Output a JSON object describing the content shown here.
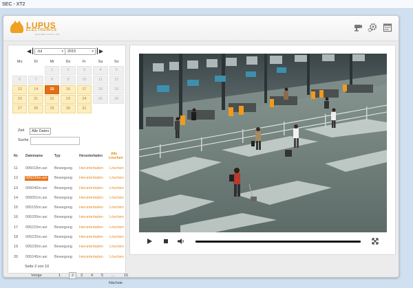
{
  "window": {
    "title": "SEC - XT2"
  },
  "header": {
    "logo_name": "LUPUS",
    "logo_sub": "ELECTRONICS",
    "logo_tagline": "SECURE YOUR LIFE",
    "icons": [
      "camera-icon",
      "gear-icon",
      "calendar-icon"
    ]
  },
  "calendar": {
    "month": "Jul",
    "year": "2015",
    "weekdays": [
      "Mo",
      "Di",
      "Mi",
      "Do",
      "Fr",
      "Sa",
      "So"
    ],
    "rows": [
      [
        "",
        "",
        "1",
        "2",
        "3",
        "4",
        "5"
      ],
      [
        "6",
        "7",
        "8",
        "9",
        "10",
        "11",
        "12"
      ],
      [
        "13",
        "14",
        "15",
        "16",
        "17",
        "18",
        "19"
      ],
      [
        "20",
        "21",
        "22",
        "23",
        "24",
        "25",
        "26"
      ],
      [
        "27",
        "28",
        "29",
        "30",
        "31",
        "",
        ""
      ]
    ],
    "active_days": [
      "13",
      "14",
      "15",
      "16",
      "17",
      "20",
      "21",
      "22",
      "23",
      "24",
      "27",
      "28",
      "29",
      "30",
      "31"
    ],
    "today": "15"
  },
  "filter": {
    "zeit_label": "Zeit",
    "zeit_value": "Alle Daten",
    "suche_label": "Suche",
    "suche_value": ""
  },
  "table": {
    "columns": {
      "nr": "Nr.",
      "filename": "Dateiname",
      "type": "Typ",
      "download": "Herunterladen",
      "delete_line1": "Alle",
      "delete_line2": "Löschen"
    },
    "rows": [
      {
        "nr": "11",
        "filename": "095018m.avi",
        "type": "Bewegung",
        "download": "Herunterladen",
        "delete": "Löschen",
        "selected": false
      },
      {
        "nr": "12",
        "filename": "095029m.avi",
        "type": "Bewegung",
        "download": "Herunterladen",
        "delete": "Löschen",
        "selected": true
      },
      {
        "nr": "13",
        "filename": "095040m.avi",
        "type": "Bewegung",
        "download": "Herunterladen",
        "delete": "Löschen",
        "selected": false
      },
      {
        "nr": "14",
        "filename": "095051m.avi",
        "type": "Bewegung",
        "download": "Herunterladen",
        "delete": "Löschen",
        "selected": false
      },
      {
        "nr": "15",
        "filename": "095155m.avi",
        "type": "Bewegung",
        "download": "Herunterladen",
        "delete": "Löschen",
        "selected": false
      },
      {
        "nr": "16",
        "filename": "095205m.avi",
        "type": "Bewegung",
        "download": "Herunterladen",
        "delete": "Löschen",
        "selected": false
      },
      {
        "nr": "17",
        "filename": "095215m.avi",
        "type": "Bewegung",
        "download": "Herunterladen",
        "delete": "Löschen",
        "selected": false
      },
      {
        "nr": "18",
        "filename": "095225m.avi",
        "type": "Bewegung",
        "download": "Herunterladen",
        "delete": "Löschen",
        "selected": false
      },
      {
        "nr": "19",
        "filename": "095235m.avi",
        "type": "Bewegung",
        "download": "Herunterladen",
        "delete": "Löschen",
        "selected": false
      },
      {
        "nr": "20",
        "filename": "095245m.avi",
        "type": "Bewegung",
        "download": "Herunterladen",
        "delete": "Löschen",
        "selected": false
      }
    ]
  },
  "pagination": {
    "info": "Seite 2 von 10",
    "prev": "Vorige",
    "pages": [
      "1",
      "2",
      "3",
      "4",
      "5",
      "...",
      "10"
    ],
    "current": "2",
    "next": "Nächste"
  },
  "player": {
    "controls": [
      "play-icon",
      "stop-icon",
      "volume-icon",
      "fullscreen-icon"
    ]
  },
  "colors": {
    "accent": "#e58a20",
    "selected": "#e8731a",
    "calendar_active": "#fbefc2"
  }
}
